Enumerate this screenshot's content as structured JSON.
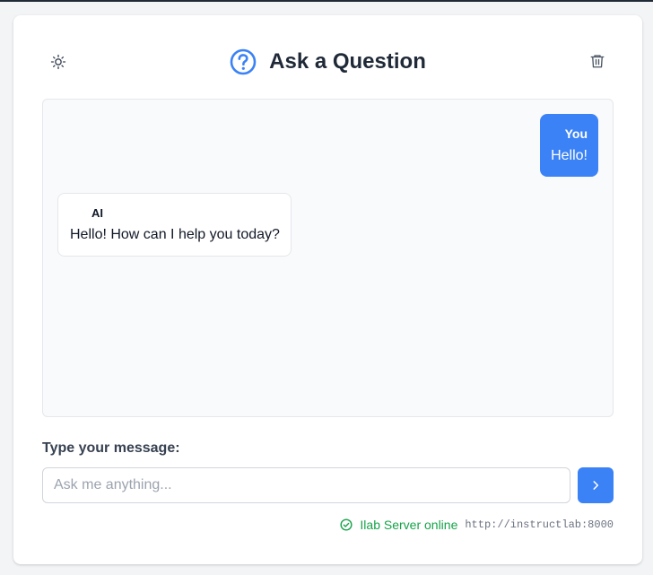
{
  "header": {
    "title": "Ask a Question"
  },
  "messages": [
    {
      "role": "user",
      "sender": "You",
      "text": "Hello!"
    },
    {
      "role": "ai",
      "sender": "AI",
      "text": "Hello! How can I help you today?"
    }
  ],
  "input": {
    "label": "Type your message:",
    "placeholder": "Ask me anything...",
    "value": ""
  },
  "status": {
    "text": "Ilab Server online",
    "url": "http://instructlab:8000"
  },
  "icons": {
    "theme_toggle": "sun-icon",
    "header": "question-circle-icon",
    "clear": "trash-icon",
    "send": "chevron-right-icon",
    "status": "check-circle-icon"
  },
  "colors": {
    "accent": "#3b82f6",
    "status_ok": "#16a34a"
  }
}
